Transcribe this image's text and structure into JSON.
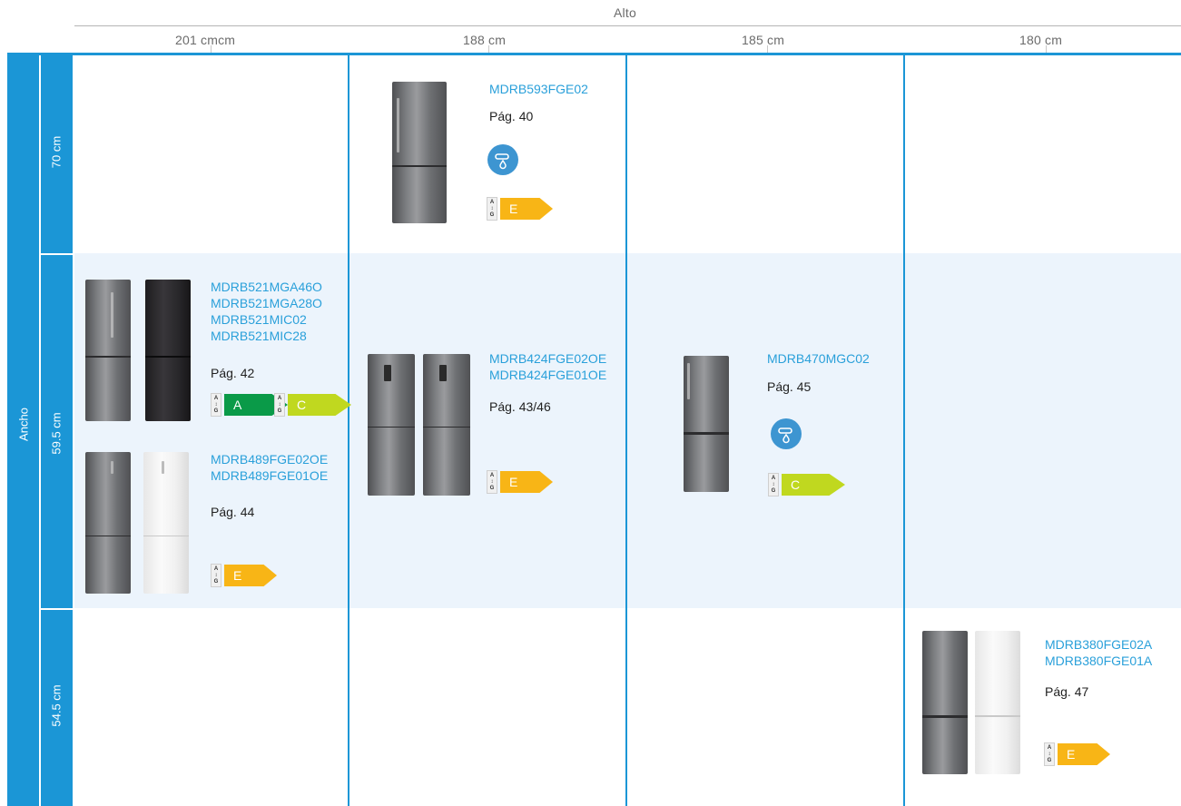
{
  "header": {
    "top_label": "Alto",
    "columns": [
      "201 cmcm",
      "188 cm",
      "185 cm",
      "180 cm"
    ]
  },
  "side": {
    "axis_label": "Ancho",
    "rows": [
      "70 cm",
      "59.5 cm",
      "54.5 cm"
    ]
  },
  "colors": {
    "accent": "#1b96d6",
    "model_text": "#2aa0da",
    "row_bg": "#ecf4fc"
  },
  "cells": {
    "r1c2": {
      "models": "MDRB593FGE02",
      "page": "Pág. 40",
      "energy": "E",
      "icon": "water-dispenser-icon"
    },
    "r2c1a": {
      "models": "MDRB521MGA46O\nMDRB521MGA28O\nMDRB521MIC02\nMDRB521MIC28",
      "page": "Pág. 42",
      "energy1": "A",
      "energy2": "C"
    },
    "r2c1b": {
      "models": "MDRB489FGE02OE\nMDRB489FGE01OE",
      "page": "Pág. 44",
      "energy": "E"
    },
    "r2c2": {
      "models": "MDRB424FGE02OE\nMDRB424FGE01OE",
      "page": "Pág. 43/46",
      "energy": "E"
    },
    "r2c3": {
      "models": "MDRB470MGC02",
      "page": "Pág. 45",
      "energy": "C",
      "icon": "water-dispenser-icon"
    },
    "r3c4": {
      "models": "MDRB380FGE02A\nMDRB380FGE01A",
      "page": "Pág. 47",
      "energy": "E"
    }
  }
}
